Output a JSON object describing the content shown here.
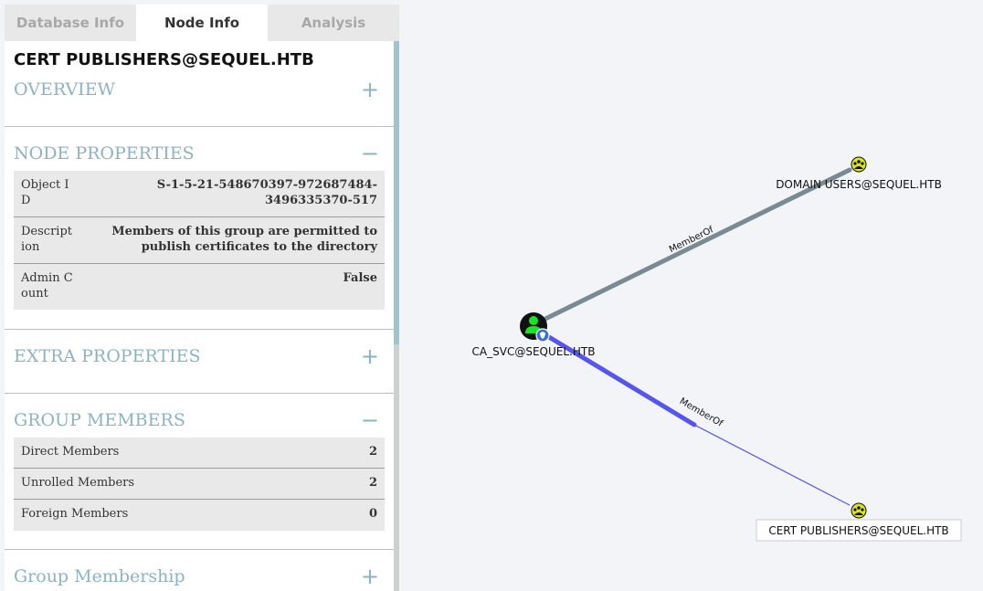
{
  "tabs": [
    {
      "label": "Database Info",
      "active": false
    },
    {
      "label": "Node Info",
      "active": true
    },
    {
      "label": "Analysis",
      "active": false
    }
  ],
  "node": {
    "title": "CERT PUBLISHERS@SEQUEL.HTB",
    "sections": {
      "overview": {
        "label": "OVERVIEW",
        "toggle": "+"
      },
      "node_properties": {
        "label": "NODE PROPERTIES",
        "toggle": "−",
        "rows": [
          {
            "key": "Object ID",
            "value": "S-1-5-21-548670397-972687484-3496335370-517"
          },
          {
            "key": "Description",
            "value": "Members of this group are permitted to publish certificates to the directory"
          },
          {
            "key": "Admin Count",
            "value": "False"
          }
        ]
      },
      "extra_properties": {
        "label": "EXTRA PROPERTIES",
        "toggle": "+"
      },
      "group_members": {
        "label": "GROUP MEMBERS",
        "toggle": "−",
        "rows": [
          {
            "key": "Direct Members",
            "value": "2"
          },
          {
            "key": "Unrolled Members",
            "value": "2"
          },
          {
            "key": "Foreign Members",
            "value": "0"
          }
        ]
      },
      "group_membership": {
        "label": "Group Membership",
        "toggle": "+"
      }
    }
  },
  "graph": {
    "nodes": {
      "ca_svc": {
        "label": "CA_SVC@SEQUEL.HTB",
        "type": "user"
      },
      "domain_users": {
        "label": "DOMAIN USERS@SEQUEL.HTB",
        "type": "group"
      },
      "cert_publishers": {
        "label": "CERT PUBLISHERS@SEQUEL.HTB",
        "type": "group"
      }
    },
    "edges": {
      "to_domain_users": {
        "label": "MemberOf"
      },
      "to_cert_publishers": {
        "label": "MemberOf"
      }
    },
    "colors": {
      "user_node": "#17e625",
      "group_node": "#dbe617",
      "edge_default": "#7a8a92",
      "edge_highlight": "#5656ee"
    }
  }
}
